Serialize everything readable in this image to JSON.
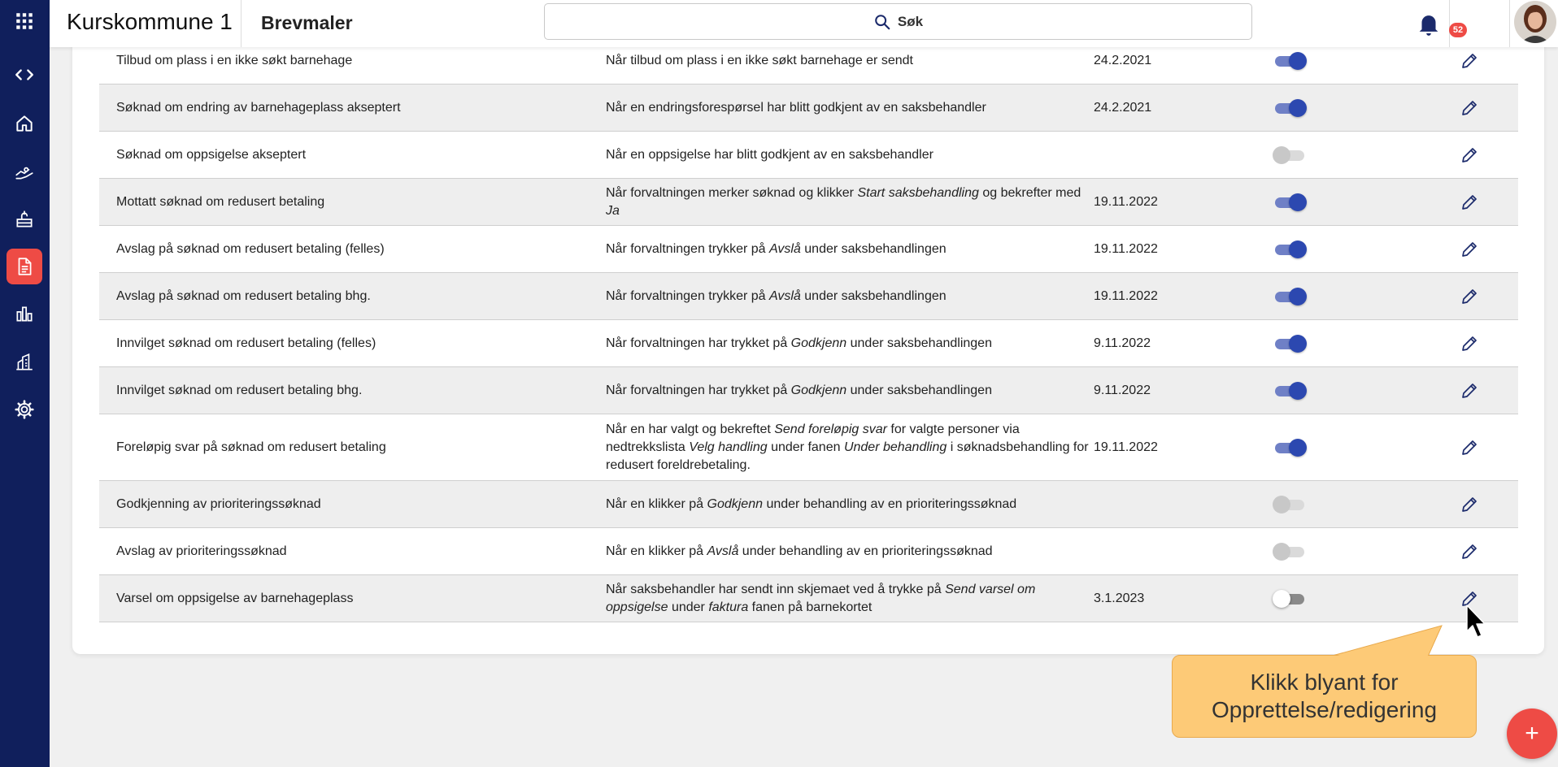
{
  "app": {
    "title": "Kurskommune 1",
    "page_title": "Brevmaler",
    "search_label": "Søk",
    "notification_count": "52",
    "accent_color": "#ee4b45",
    "sidebar_color": "#101f5c"
  },
  "sidebar": {
    "items": [
      {
        "icon": "apps-grid-icon"
      },
      {
        "icon": "code-expand-icon"
      },
      {
        "icon": "home-icon"
      },
      {
        "icon": "hands-icon"
      },
      {
        "icon": "kindergarten-icon"
      },
      {
        "icon": "document-icon",
        "active": true
      },
      {
        "icon": "bar-chart-icon"
      },
      {
        "icon": "buildings-icon"
      },
      {
        "icon": "settings-icon"
      }
    ]
  },
  "rows": [
    {
      "name": "Tilbud om plass i en ikke søkt barnehage",
      "description": [
        "Når tilbud om plass i en ikke søkt barnehage er sendt"
      ],
      "date": "24.2.2021",
      "enabled": true
    },
    {
      "name": "Søknad om endring av barnehageplass akseptert",
      "description": [
        "Når en endringsforespørsel har blitt godkjent av en saksbehandler"
      ],
      "date": "24.2.2021",
      "enabled": true
    },
    {
      "name": "Søknad om oppsigelse akseptert",
      "description": [
        "Når en oppsigelse har blitt godkjent av en saksbehandler"
      ],
      "date": "",
      "enabled": false
    },
    {
      "name": "Mottatt søknad om redusert betaling",
      "description": [
        "Når forvaltningen merker søknad og klikker ",
        {
          "i": "Start saksbehandling"
        },
        " og bekrefter med ",
        {
          "i": "Ja"
        }
      ],
      "date": "19.11.2022",
      "enabled": true
    },
    {
      "name": "Avslag på søknad om redusert betaling (felles)",
      "description": [
        "Når forvaltningen trykker på ",
        {
          "i": "Avslå"
        },
        " under saksbehandlingen"
      ],
      "date": "19.11.2022",
      "enabled": true
    },
    {
      "name": "Avslag på søknad om redusert betaling bhg.",
      "description": [
        "Når forvaltningen trykker på ",
        {
          "i": "Avslå"
        },
        " under saksbehandlingen"
      ],
      "date": "19.11.2022",
      "enabled": true
    },
    {
      "name": "Innvilget søknad om redusert betaling (felles)",
      "description": [
        "Når forvaltningen har trykket på ",
        {
          "i": "Godkjenn"
        },
        " under saksbehandlingen"
      ],
      "date": "9.11.2022",
      "enabled": true
    },
    {
      "name": "Innvilget søknad om redusert betaling bhg.",
      "description": [
        "Når forvaltningen har trykket på ",
        {
          "i": "Godkjenn"
        },
        " under saksbehandlingen"
      ],
      "date": "9.11.2022",
      "enabled": true
    },
    {
      "name": "Foreløpig svar på søknad om redusert betaling",
      "description": [
        "Når en har valgt og bekreftet ",
        {
          "i": "Send foreløpig svar"
        },
        " for valgte personer via nedtrekkslista ",
        {
          "i": "Velg handling"
        },
        " under fanen ",
        {
          "i": "Under behandling"
        },
        " i søknadsbehandling for redusert foreldrebetaling."
      ],
      "date": "19.11.2022",
      "enabled": true
    },
    {
      "name": "Godkjenning av prioriteringssøknad",
      "description": [
        "Når en klikker på ",
        {
          "i": "Godkjenn"
        },
        " under behandling av en prioriteringssøknad"
      ],
      "date": "",
      "enabled": false
    },
    {
      "name": "Avslag av prioriteringssøknad",
      "description": [
        "Når en klikker på ",
        {
          "i": "Avslå"
        },
        " under behandling av en prioriteringssøknad"
      ],
      "date": "",
      "enabled": false
    },
    {
      "name": "Varsel om oppsigelse av barnehageplass",
      "description": [
        "Når saksbehandler har sendt inn skjemaet ved å trykke på ",
        {
          "i": "Send varsel om oppsigelse"
        },
        " under ",
        {
          "i": "faktura"
        },
        " fanen på barnekortet"
      ],
      "date": "3.1.2023",
      "enabled": false,
      "hovered": true
    }
  ],
  "callout": {
    "text_line1": "Klikk blyant for",
    "text_line2": "Opprettelse/redigering"
  },
  "fab_label": "+"
}
